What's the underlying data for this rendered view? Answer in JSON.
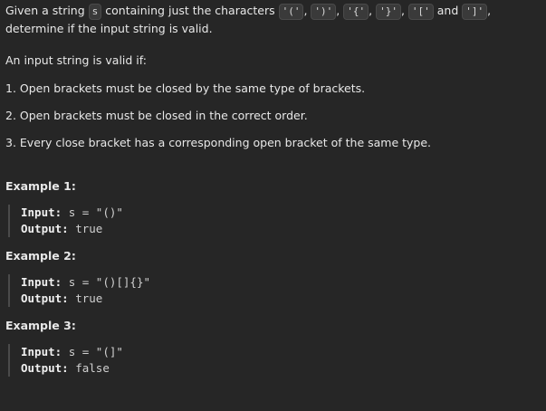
{
  "intro": {
    "pre": "Given a string",
    "var_s": "s",
    "mid": "containing just the characters",
    "chars": [
      "'('",
      "')'",
      "'{'",
      "'}'",
      "'['",
      "']'"
    ],
    "and": "and",
    "post": ", determine if the input string is valid."
  },
  "valid_intro": "An input string is valid if:",
  "rules": [
    "1. Open brackets must be closed by the same type of brackets.",
    "2. Open brackets must be closed in the correct order.",
    "3. Every close bracket has a corresponding open bracket of the same type."
  ],
  "examples": [
    {
      "title": "Example 1:",
      "input_label": "Input:",
      "input_value": "s = \"()\"",
      "output_label": "Output:",
      "output_value": "true"
    },
    {
      "title": "Example 2:",
      "input_label": "Input:",
      "input_value": "s = \"()[]{}\"",
      "output_label": "Output:",
      "output_value": "true"
    },
    {
      "title": "Example 3:",
      "input_label": "Input:",
      "input_value": "s = \"(]\"",
      "output_label": "Output:",
      "output_value": "false"
    }
  ]
}
